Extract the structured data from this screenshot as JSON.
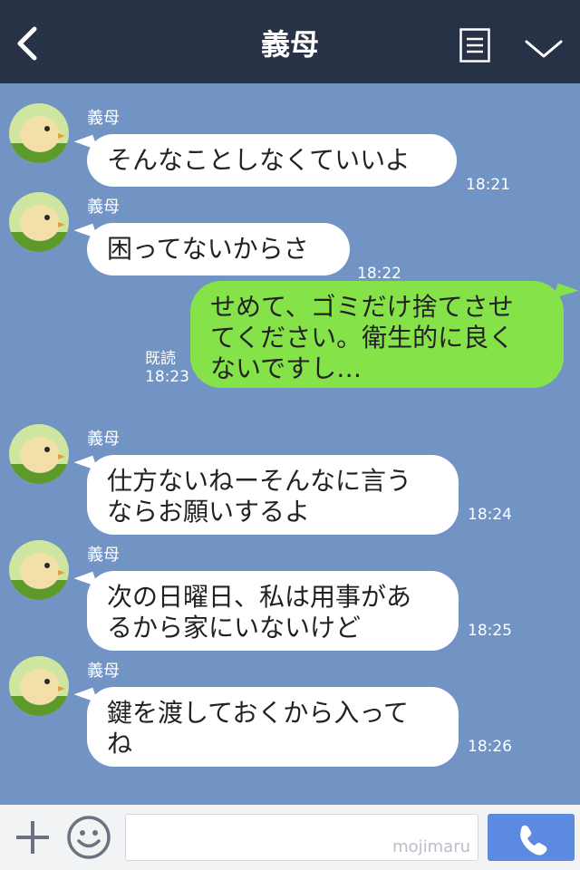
{
  "header": {
    "title": "義母"
  },
  "messages_in": [
    {
      "sender": "義母",
      "lines": [
        "そんなことしなくていいよ"
      ],
      "time": "18:21"
    },
    {
      "sender": "義母",
      "lines": [
        "困ってないからさ"
      ],
      "time": "18:22"
    },
    {
      "sender": "義母",
      "lines": [
        "仕方ないねーそんなに言う",
        "ならお願いするよ"
      ],
      "time": "18:24"
    },
    {
      "sender": "義母",
      "lines": [
        "次の日曜日、私は用事があ",
        "るから家にいないけど"
      ],
      "time": "18:25"
    },
    {
      "sender": "義母",
      "lines": [
        "鍵を渡しておくから入って",
        "ね"
      ],
      "time": "18:26"
    }
  ],
  "message_out": {
    "lines": [
      "せめて、ゴミだけ捨てさせ",
      "てください。衛生的に良く",
      "ないですし…"
    ],
    "read_label": "既読",
    "time": "18:23"
  },
  "footer": {
    "watermark": "mojimaru"
  },
  "colors": {
    "header_bg": "#273246",
    "chat_bg": "#7294c4",
    "out_bubble": "#85e249",
    "call_button": "#5b8ae0"
  },
  "icons": [
    "back-chevron-icon",
    "notes-icon",
    "chevron-down-icon",
    "plus-icon",
    "smile-icon",
    "phone-icon",
    "chick-avatar"
  ]
}
